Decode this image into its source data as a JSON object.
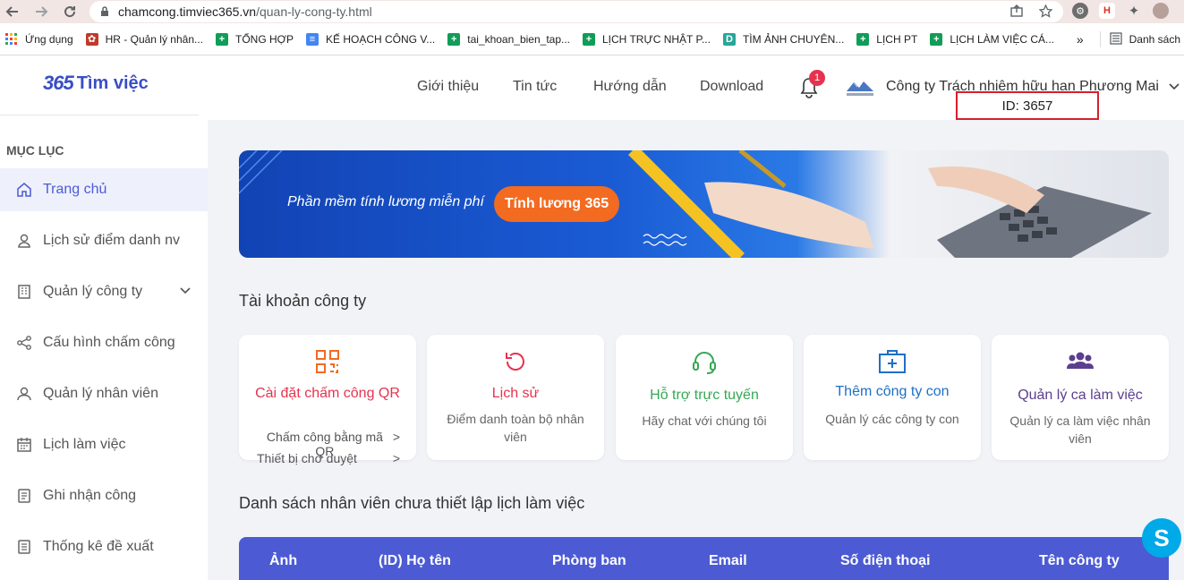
{
  "browser": {
    "url_host": "chamcong.timviec365.vn",
    "url_path": "/quan-ly-cong-ty.html",
    "bookmarks": [
      {
        "label": "Ứng dụng",
        "color": "#e94235"
      },
      {
        "label": "HR - Quản lý nhân...",
        "color": "#c0392b"
      },
      {
        "label": "TỔNG HỢP",
        "color": "#0f9d58"
      },
      {
        "label": "KẾ HOẠCH CÔNG V...",
        "color": "#4285f4"
      },
      {
        "label": "tai_khoan_bien_tap...",
        "color": "#0f9d58"
      },
      {
        "label": "LỊCH TRỰC NHẬT P...",
        "color": "#0f9d58"
      },
      {
        "label": "TÌM ẢNH CHUYÊN...",
        "color": "#26a69a"
      },
      {
        "label": "LỊCH PT",
        "color": "#0f9d58"
      },
      {
        "label": "LỊCH LÀM VIỆC CÁ...",
        "color": "#0f9d58"
      }
    ],
    "more": "»",
    "reading_list": "Danh sách"
  },
  "sidebar": {
    "logo_num": "365",
    "logo_text": "Tìm việc",
    "menu_title": "MỤC LỤC",
    "items": [
      {
        "label": "Trang chủ",
        "icon": "home-icon"
      },
      {
        "label": "Lịch sử điểm danh nv",
        "icon": "user-history-icon"
      },
      {
        "label": "Quản lý công ty",
        "icon": "building-icon"
      },
      {
        "label": "Cấu hình chấm công",
        "icon": "share-icon"
      },
      {
        "label": "Quản lý nhân viên",
        "icon": "user-icon"
      },
      {
        "label": "Lịch làm việc",
        "icon": "calendar-icon"
      },
      {
        "label": "Ghi nhận công",
        "icon": "note-icon"
      },
      {
        "label": "Thống kê đề xuất",
        "icon": "stats-icon"
      }
    ]
  },
  "header": {
    "links": [
      "Giới thiệu",
      "Tin tức",
      "Hướng dẫn",
      "Download"
    ],
    "notification_count": "1",
    "company_name": "Công ty Trách nhiệm hữu hạn Phương Mai",
    "company_id": "ID: 3657"
  },
  "banner": {
    "text": "Phần mềm tính lương miễn phí",
    "button": "Tính lương 365"
  },
  "account_section": {
    "title": "Tài khoản công ty",
    "cards": [
      {
        "title": "Cài đặt chấm công QR",
        "row1": "Chấm công bằng mã QR",
        "row2": "Thiết bị chờ duyệt",
        "arrow": ">",
        "color": "#e5334f"
      },
      {
        "title": "Lịch sử",
        "sub": "Điểm danh toàn bộ nhân viên",
        "color": "#e5334f"
      },
      {
        "title": "Hỗ trợ trực tuyến",
        "sub": "Hãy chat với chúng tôi",
        "color": "#34a853"
      },
      {
        "title": "Thêm công ty con",
        "sub": "Quản lý các công ty con",
        "color": "#1f6fc5"
      },
      {
        "title": "Quản lý ca làm việc",
        "sub": "Quản lý ca làm việc nhân viên",
        "color": "#5b3e8e"
      }
    ]
  },
  "employee_section": {
    "title": "Danh sách nhân viên chưa thiết lập lịch làm việc",
    "columns": [
      "Ảnh",
      "(ID) Họ tên",
      "Phòng ban",
      "Email",
      "Số điện thoại",
      "Tên công ty"
    ]
  },
  "colors": {
    "primary": "#4c5bd4",
    "accent_orange": "#f26b21",
    "id_border": "#d61f2c"
  }
}
